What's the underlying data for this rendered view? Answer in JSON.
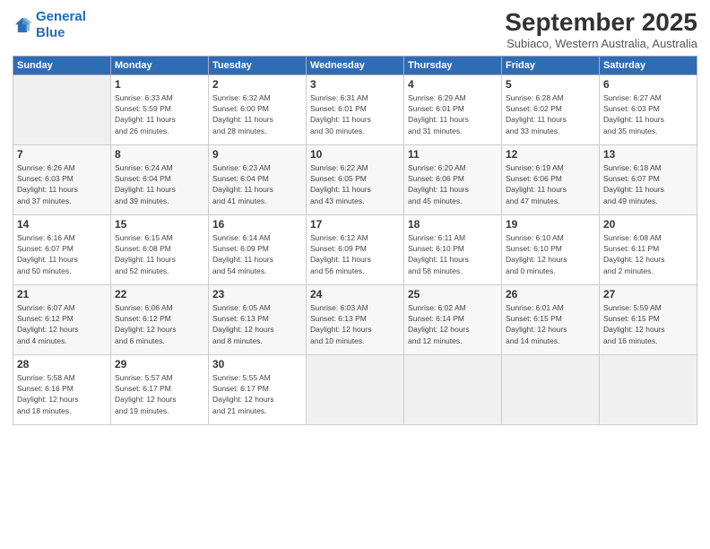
{
  "logo": {
    "line1": "General",
    "line2": "Blue"
  },
  "title": "September 2025",
  "subtitle": "Subiaco, Western Australia, Australia",
  "weekdays": [
    "Sunday",
    "Monday",
    "Tuesday",
    "Wednesday",
    "Thursday",
    "Friday",
    "Saturday"
  ],
  "weeks": [
    [
      {
        "day": "",
        "info": ""
      },
      {
        "day": "1",
        "info": "Sunrise: 6:33 AM\nSunset: 5:59 PM\nDaylight: 11 hours\nand 26 minutes."
      },
      {
        "day": "2",
        "info": "Sunrise: 6:32 AM\nSunset: 6:00 PM\nDaylight: 11 hours\nand 28 minutes."
      },
      {
        "day": "3",
        "info": "Sunrise: 6:31 AM\nSunset: 6:01 PM\nDaylight: 11 hours\nand 30 minutes."
      },
      {
        "day": "4",
        "info": "Sunrise: 6:29 AM\nSunset: 6:01 PM\nDaylight: 11 hours\nand 31 minutes."
      },
      {
        "day": "5",
        "info": "Sunrise: 6:28 AM\nSunset: 6:02 PM\nDaylight: 11 hours\nand 33 minutes."
      },
      {
        "day": "6",
        "info": "Sunrise: 6:27 AM\nSunset: 6:03 PM\nDaylight: 11 hours\nand 35 minutes."
      }
    ],
    [
      {
        "day": "7",
        "info": "Sunrise: 6:26 AM\nSunset: 6:03 PM\nDaylight: 11 hours\nand 37 minutes."
      },
      {
        "day": "8",
        "info": "Sunrise: 6:24 AM\nSunset: 6:04 PM\nDaylight: 11 hours\nand 39 minutes."
      },
      {
        "day": "9",
        "info": "Sunrise: 6:23 AM\nSunset: 6:04 PM\nDaylight: 11 hours\nand 41 minutes."
      },
      {
        "day": "10",
        "info": "Sunrise: 6:22 AM\nSunset: 6:05 PM\nDaylight: 11 hours\nand 43 minutes."
      },
      {
        "day": "11",
        "info": "Sunrise: 6:20 AM\nSunset: 6:06 PM\nDaylight: 11 hours\nand 45 minutes."
      },
      {
        "day": "12",
        "info": "Sunrise: 6:19 AM\nSunset: 6:06 PM\nDaylight: 11 hours\nand 47 minutes."
      },
      {
        "day": "13",
        "info": "Sunrise: 6:18 AM\nSunset: 6:07 PM\nDaylight: 11 hours\nand 49 minutes."
      }
    ],
    [
      {
        "day": "14",
        "info": "Sunrise: 6:16 AM\nSunset: 6:07 PM\nDaylight: 11 hours\nand 50 minutes."
      },
      {
        "day": "15",
        "info": "Sunrise: 6:15 AM\nSunset: 6:08 PM\nDaylight: 11 hours\nand 52 minutes."
      },
      {
        "day": "16",
        "info": "Sunrise: 6:14 AM\nSunset: 6:09 PM\nDaylight: 11 hours\nand 54 minutes."
      },
      {
        "day": "17",
        "info": "Sunrise: 6:12 AM\nSunset: 6:09 PM\nDaylight: 11 hours\nand 56 minutes."
      },
      {
        "day": "18",
        "info": "Sunrise: 6:11 AM\nSunset: 6:10 PM\nDaylight: 11 hours\nand 58 minutes."
      },
      {
        "day": "19",
        "info": "Sunrise: 6:10 AM\nSunset: 6:10 PM\nDaylight: 12 hours\nand 0 minutes."
      },
      {
        "day": "20",
        "info": "Sunrise: 6:08 AM\nSunset: 6:11 PM\nDaylight: 12 hours\nand 2 minutes."
      }
    ],
    [
      {
        "day": "21",
        "info": "Sunrise: 6:07 AM\nSunset: 6:12 PM\nDaylight: 12 hours\nand 4 minutes."
      },
      {
        "day": "22",
        "info": "Sunrise: 6:06 AM\nSunset: 6:12 PM\nDaylight: 12 hours\nand 6 minutes."
      },
      {
        "day": "23",
        "info": "Sunrise: 6:05 AM\nSunset: 6:13 PM\nDaylight: 12 hours\nand 8 minutes."
      },
      {
        "day": "24",
        "info": "Sunrise: 6:03 AM\nSunset: 6:13 PM\nDaylight: 12 hours\nand 10 minutes."
      },
      {
        "day": "25",
        "info": "Sunrise: 6:02 AM\nSunset: 6:14 PM\nDaylight: 12 hours\nand 12 minutes."
      },
      {
        "day": "26",
        "info": "Sunrise: 6:01 AM\nSunset: 6:15 PM\nDaylight: 12 hours\nand 14 minutes."
      },
      {
        "day": "27",
        "info": "Sunrise: 5:59 AM\nSunset: 6:15 PM\nDaylight: 12 hours\nand 16 minutes."
      }
    ],
    [
      {
        "day": "28",
        "info": "Sunrise: 5:58 AM\nSunset: 6:16 PM\nDaylight: 12 hours\nand 18 minutes."
      },
      {
        "day": "29",
        "info": "Sunrise: 5:57 AM\nSunset: 6:17 PM\nDaylight: 12 hours\nand 19 minutes."
      },
      {
        "day": "30",
        "info": "Sunrise: 5:55 AM\nSunset: 6:17 PM\nDaylight: 12 hours\nand 21 minutes."
      },
      {
        "day": "",
        "info": ""
      },
      {
        "day": "",
        "info": ""
      },
      {
        "day": "",
        "info": ""
      },
      {
        "day": "",
        "info": ""
      }
    ]
  ]
}
